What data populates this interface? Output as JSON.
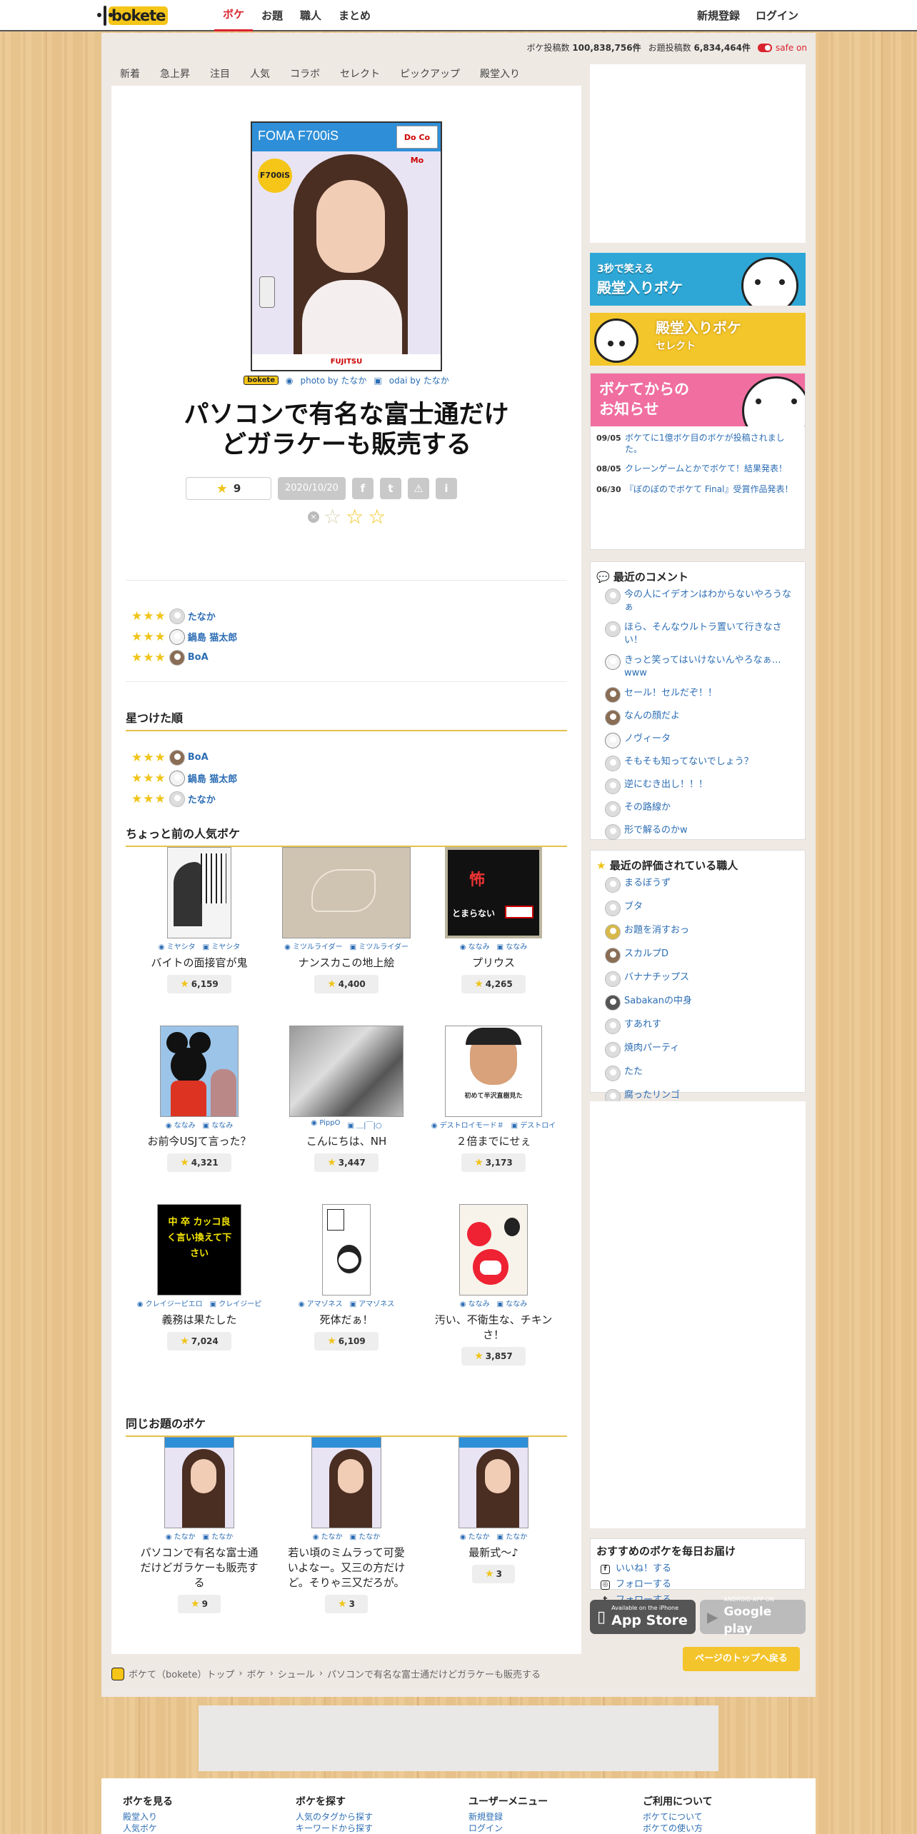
{
  "header": {
    "logo_text": "bokete",
    "nav": [
      "ボケ",
      "お題",
      "職人",
      "まとめ"
    ],
    "nav_right": [
      "新規登録",
      "ログイン"
    ]
  },
  "stats": {
    "boke_label": "ボケ投稿数",
    "boke_count": "100,838,756件",
    "odai_label": "お題投稿数",
    "odai_count": "6,834,464件",
    "safe_label": "safe on"
  },
  "subtabs": [
    "新着",
    "急上昇",
    "注目",
    "人気",
    "コラボ",
    "セレクト",
    "ピックアップ",
    "殿堂入り"
  ],
  "hero": {
    "image_text": {
      "model": "FOMA F700iS",
      "carrier": "Do Co Mo",
      "badge": "F700iS",
      "maker": "FUJITSU"
    },
    "mini_logo": "bokete",
    "photo_credit": "photo by たなか",
    "odai_credit": "odai by たなか",
    "title_line1": "パソコンで有名な富士通だけ",
    "title_line2": "どガラケーも販売する",
    "star_count": "9",
    "date": "2020/10/20"
  },
  "raters_recent": [
    {
      "name": "たなか",
      "stars": "★★★"
    },
    {
      "name": "鍋島 猫太郎",
      "stars": "★★★"
    },
    {
      "name": "BoA",
      "stars": "★★★"
    }
  ],
  "section_starred": "星つけた順",
  "raters_by_star": [
    {
      "name": "BoA",
      "stars": "★★★"
    },
    {
      "name": "鍋島 猫太郎",
      "stars": "★★★"
    },
    {
      "name": "たなか",
      "stars": "★★★"
    }
  ],
  "section_popular": "ちょっと前の人気ボケ",
  "popular": [
    {
      "photo": "ミヤシタ",
      "odai": "ミヤシタ",
      "caption": "バイトの面接官が鬼",
      "count": "6,159",
      "thumb_text": ""
    },
    {
      "photo": "ミツルライダー",
      "odai": "ミツルライダー",
      "caption": "ナンスカこの地上絵",
      "count": "4,400",
      "thumb_text": ""
    },
    {
      "photo": "ななみ",
      "odai": "ななみ",
      "caption": "プリウス",
      "count": "4,265",
      "thumb_text": "とまらない"
    },
    {
      "photo": "ななみ",
      "odai": "ななみ",
      "caption": "お前今USJて言った？",
      "count": "4,321",
      "thumb_text": ""
    },
    {
      "photo": "PippO",
      "odai": "＿|￣|○",
      "caption": "こんにちは、NH",
      "count": "3,447",
      "thumb_text": ""
    },
    {
      "photo": "デストロイモード＃",
      "odai": "デストロイ",
      "caption": "２倍までにせぇ",
      "count": "3,173",
      "thumb_text": "初めて半沢直樹見た"
    },
    {
      "photo": "クレイジーピエロ",
      "odai": "クレイジーピ",
      "caption": "義務は果たした",
      "count": "7,024",
      "thumb_text": "中 卒 カッコ良く言い換えて下さい"
    },
    {
      "photo": "アマゾネス",
      "odai": "アマゾネス",
      "caption": "死体だぁ！",
      "count": "6,109",
      "thumb_text": ""
    },
    {
      "photo": "ななみ",
      "odai": "ななみ",
      "caption": "汚い、不衛生な、チキンさ！",
      "count": "3,857",
      "thumb_text": ""
    }
  ],
  "section_same": "同じお題のボケ",
  "same_odai": [
    {
      "photo": "たなか",
      "odai": "たなか",
      "caption": "パソコンで有名な富士通だけどガラケーも販売する",
      "count": "9"
    },
    {
      "photo": "たなか",
      "odai": "たなか",
      "caption": "若い頃のミムラって可愛いよなー。又三の方だけど。そりゃ三又だろが。",
      "count": "3"
    },
    {
      "photo": "たなか",
      "odai": "たなか",
      "caption": "最新式〜♪",
      "count": "3"
    }
  ],
  "sidebar": {
    "banner1": {
      "line1": "3秒で笑える",
      "line2": "殿堂入りボケ"
    },
    "banner2": {
      "line1": "殿堂入りボケ",
      "line2": "セレクト"
    },
    "banner3": {
      "line1": "ボケてからの",
      "line2": "お知らせ"
    },
    "news": [
      {
        "date": "09/05",
        "text": "ボケてに1億ボケ目のボケが投稿されました。"
      },
      {
        "date": "08/05",
        "text": "クレーンゲームとかでボケて！結果発表！"
      },
      {
        "date": "06/30",
        "text": "『ぼのぼのでボケて Final』受賞作品発表！"
      }
    ],
    "comments_title": "最近のコメント",
    "comments": [
      "今の人にイデオンはわからないやろうなぁ",
      "ほら、そんなウルトラ置いて行きなさい！",
      "きっと笑ってはいけないんやろなぁ…www",
      "セール！セルだぞ！！",
      "なんの顔だよ",
      "ノヴィータ",
      "そもそも知ってないでしょう？",
      "逆にむき出し！！！",
      "その路線か",
      "形で解るのかw"
    ],
    "artisans_title": "最近の評価されている職人",
    "artisans": [
      "まるぼうず",
      "ブタ",
      "お題を消すおっ",
      "スカルプD",
      "バナナチップス",
      "Sabakanの中身",
      "すあれす",
      "焼肉パーティ",
      "たた",
      "腐ったリンゴ"
    ],
    "follow_title": "おすすめのボケを毎日お届け",
    "follow": [
      {
        "icon": "f",
        "text": "いいね！する"
      },
      {
        "icon": "◎",
        "text": "フォローする"
      },
      {
        "icon": "t",
        "text": "フォローする"
      }
    ],
    "app_store": {
      "small": "Available on the iPhone",
      "big": "App Store"
    },
    "google_play": {
      "small": "ANDROID APP ON",
      "big": "Google play"
    }
  },
  "to_top": "ページのトップへ戻る",
  "breadcrumb": [
    "ボケて（bokete）トップ",
    "ボケ",
    "シュール",
    "パソコンで有名な富士通だけどガラケーも販売する"
  ],
  "footer": [
    {
      "head": "ボケを見る",
      "links": [
        "殿堂入り",
        "人気ボケ"
      ]
    },
    {
      "head": "ボケを探す",
      "links": [
        "人気のタグから探す",
        "キーワードから探す"
      ]
    },
    {
      "head": "ユーザーメニュー",
      "links": [
        "新規登録",
        "ログイン"
      ]
    },
    {
      "head": "ご利用について",
      "links": [
        "ボケてについて",
        "ボケての使い方"
      ]
    }
  ],
  "colors": {
    "accent": "#d9232e",
    "link": "#2c6db4",
    "star": "#f0c419",
    "section_rule": "#e4c24a"
  }
}
